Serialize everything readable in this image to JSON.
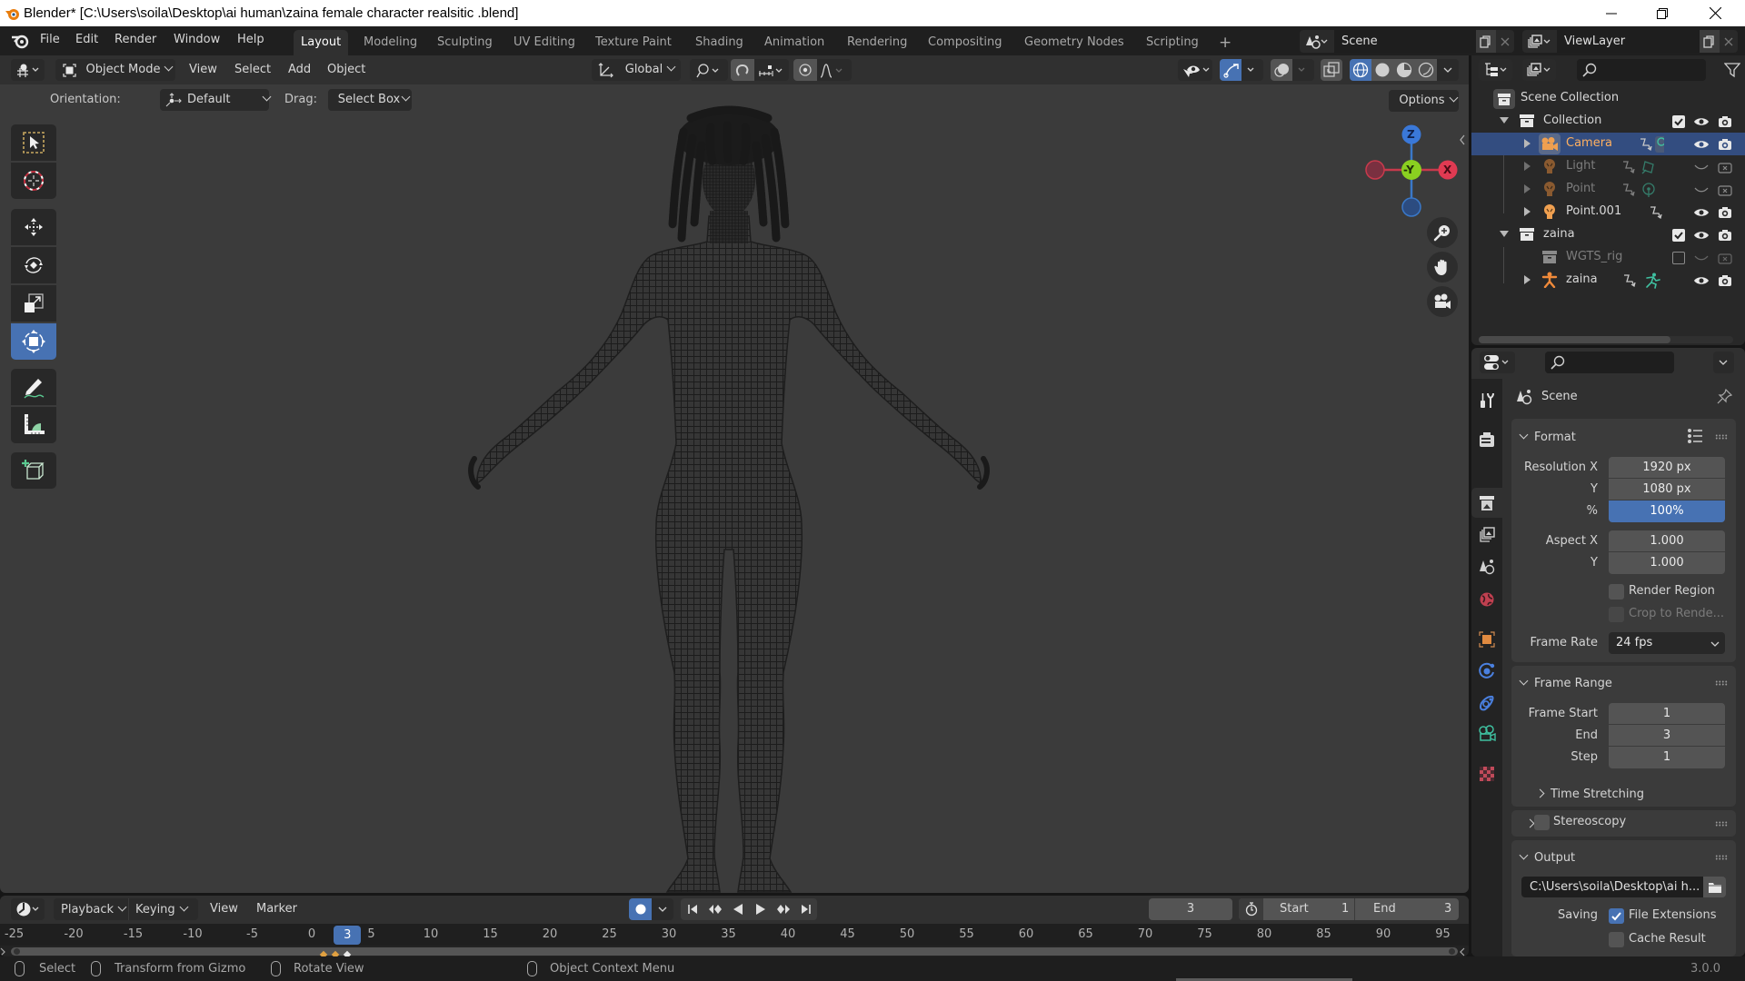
{
  "window": {
    "title": "Blender* [C:\\Users\\soila\\Desktop\\ai human\\zaina female character realsitic .blend]"
  },
  "topbar": {
    "menus": [
      "File",
      "Edit",
      "Render",
      "Window",
      "Help"
    ],
    "workspaces": [
      "Layout",
      "Modeling",
      "Sculpting",
      "UV Editing",
      "Texture Paint",
      "Shading",
      "Animation",
      "Rendering",
      "Compositing",
      "Geometry Nodes",
      "Scripting"
    ],
    "active_workspace": "Layout",
    "add_workspace": "+",
    "scene": "Scene",
    "view_layer": "ViewLayer"
  },
  "viewport": {
    "mode": "Object Mode",
    "menus": [
      "View",
      "Select",
      "Add",
      "Object"
    ],
    "transform_orientation": "Global",
    "tool_settings": {
      "orientation_label": "Orientation:",
      "orientation_value": "Default",
      "drag_label": "Drag:",
      "drag_value": "Select Box",
      "options": "Options"
    },
    "shading_mode": "wireframe",
    "gizmo": {
      "z": "Z",
      "y": "-Y",
      "x": "X"
    },
    "tools": [
      "select-box",
      "cursor",
      "move",
      "rotate",
      "scale",
      "transform",
      "annotate",
      "measure",
      "add-cube"
    ],
    "active_tool": "transform",
    "accent_color": "#4772b3"
  },
  "outliner": {
    "root": "Scene Collection",
    "rows": [
      {
        "label": "Collection",
        "type": "collection",
        "expanded": true,
        "enabled": true
      },
      {
        "label": "Camera",
        "type": "camera",
        "selected": true,
        "visible": true
      },
      {
        "label": "Light",
        "type": "light",
        "visible": false
      },
      {
        "label": "Point",
        "type": "light",
        "visible": false
      },
      {
        "label": "Point.001",
        "type": "light",
        "visible": true
      },
      {
        "label": "zaina",
        "type": "collection",
        "expanded": true,
        "enabled": true
      },
      {
        "label": "WGTS_rig",
        "type": "collection",
        "enabled": false
      },
      {
        "label": "zaina",
        "type": "armature",
        "visible": true
      }
    ]
  },
  "properties": {
    "context": "Scene",
    "active_tab": "Output",
    "format": {
      "title": "Format",
      "resolution_x_label": "Resolution X",
      "resolution_x": "1920 px",
      "resolution_y_label": "Y",
      "resolution_y": "1080 px",
      "percent_label": "%",
      "percent": "100%",
      "aspect_x_label": "Aspect X",
      "aspect_x": "1.000",
      "aspect_y_label": "Y",
      "aspect_y": "1.000",
      "render_region": "Render Region",
      "render_region_checked": false,
      "crop": "Crop to Rende...",
      "frame_rate_label": "Frame Rate",
      "frame_rate": "24 fps"
    },
    "frame_range": {
      "title": "Frame Range",
      "start_label": "Frame Start",
      "start": "1",
      "end_label": "End",
      "end": "3",
      "step_label": "Step",
      "step": "1",
      "time_stretching": "Time Stretching"
    },
    "stereoscopy": {
      "title": "Stereoscopy",
      "checked": false
    },
    "output": {
      "title": "Output",
      "path": "C:\\Users\\soila\\Desktop\\ai h...",
      "saving_label": "Saving",
      "file_extensions": "File Extensions",
      "file_extensions_checked": true,
      "cache_result": "Cache Result",
      "cache_result_checked": false
    }
  },
  "timeline": {
    "menus": [
      "Playback",
      "Keying",
      "View",
      "Marker"
    ],
    "current_frame": 3,
    "current_frame_label": "3",
    "start_label": "Start",
    "start": "1",
    "end_label": "End",
    "end": "3",
    "ruler_ticks": [
      -25,
      -20,
      -15,
      -10,
      -5,
      0,
      5,
      10,
      15,
      20,
      25,
      30,
      35,
      40,
      45,
      50,
      55,
      60,
      65,
      70,
      75,
      80,
      85,
      90,
      95
    ],
    "keyframes": [
      1,
      2,
      3
    ]
  },
  "statusbar": {
    "select": "Select",
    "transform": "Transform from Gizmo",
    "rotate": "Rotate View",
    "context_menu": "Object Context Menu",
    "version": "3.0.0"
  }
}
